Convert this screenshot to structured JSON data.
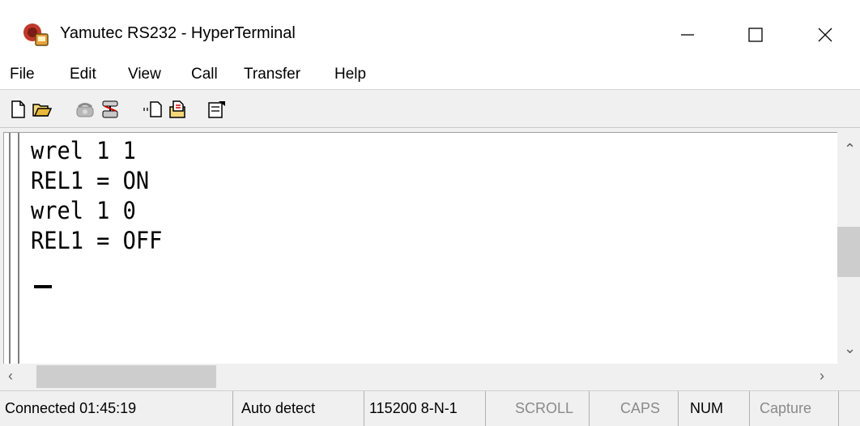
{
  "window": {
    "title": "Yamutec RS232 - HyperTerminal"
  },
  "menu": {
    "items": [
      "File",
      "Edit",
      "View",
      "Call",
      "Transfer",
      "Help"
    ]
  },
  "toolbar": {
    "icons": [
      "new-connection-icon",
      "open-icon",
      "phone-icon",
      "disconnect-icon",
      "send-icon",
      "receive-icon",
      "properties-icon"
    ]
  },
  "terminal": {
    "lines": [
      "wrel 1 1",
      "REL1 = ON",
      "wrel 1 0",
      "REL1 = OFF"
    ]
  },
  "status": {
    "connected": "Connected 01:45:19",
    "detect": "Auto detect",
    "settings": "115200 8-N-1",
    "scroll": "SCROLL",
    "caps": "CAPS",
    "num": "NUM",
    "capture": "Capture"
  },
  "colors": {
    "terminal_bg": "#ffffff",
    "chrome_bg": "#f0f0f0",
    "disabled_text": "#8a8a8a"
  }
}
